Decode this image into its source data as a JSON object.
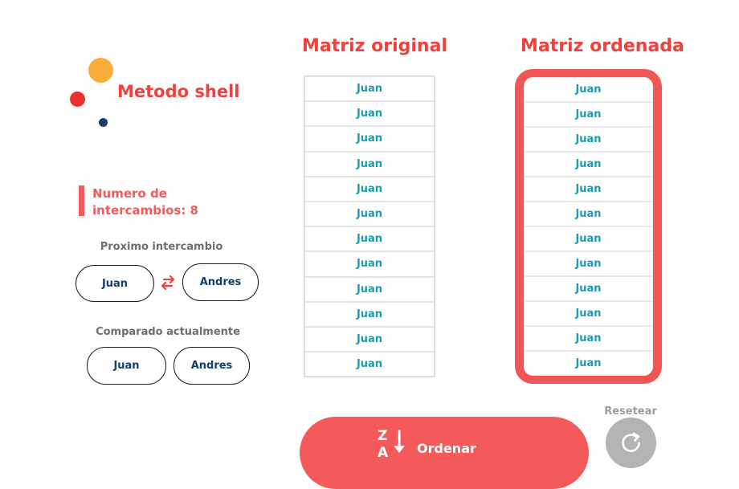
{
  "app": {
    "title": "Metodo shell",
    "colors": {
      "accent": "#f0413e",
      "navy": "#123f6e",
      "teal": "#1b9bb4",
      "orange": "#f9ae3b"
    }
  },
  "stats": {
    "swaps_label": "Numero de intercambios: 8"
  },
  "next_swap": {
    "label": "Proximo intercambio",
    "left": "Juan",
    "right": "Andres",
    "icon": "swap-arrows-icon"
  },
  "current_compare": {
    "label": "Comparado actualmente",
    "left": "Juan",
    "right": "Andres"
  },
  "original": {
    "title": "Matriz original",
    "items": [
      "Juan",
      "Juan",
      "Juan",
      "Juan",
      "Juan",
      "Juan",
      "Juan",
      "Juan",
      "Juan",
      "Juan",
      "Juan",
      "Juan"
    ]
  },
  "sorted": {
    "title": "Matriz ordenada",
    "items": [
      "Juan",
      "Juan",
      "Juan",
      "Juan",
      "Juan",
      "Juan",
      "Juan",
      "Juan",
      "Juan",
      "Juan",
      "Juan",
      "Juan"
    ]
  },
  "actions": {
    "sort_label": "Ordenar",
    "sort_icon": "sort-z-a-down-icon",
    "reset_label": "Resetear",
    "reset_icon": "reset-icon"
  }
}
